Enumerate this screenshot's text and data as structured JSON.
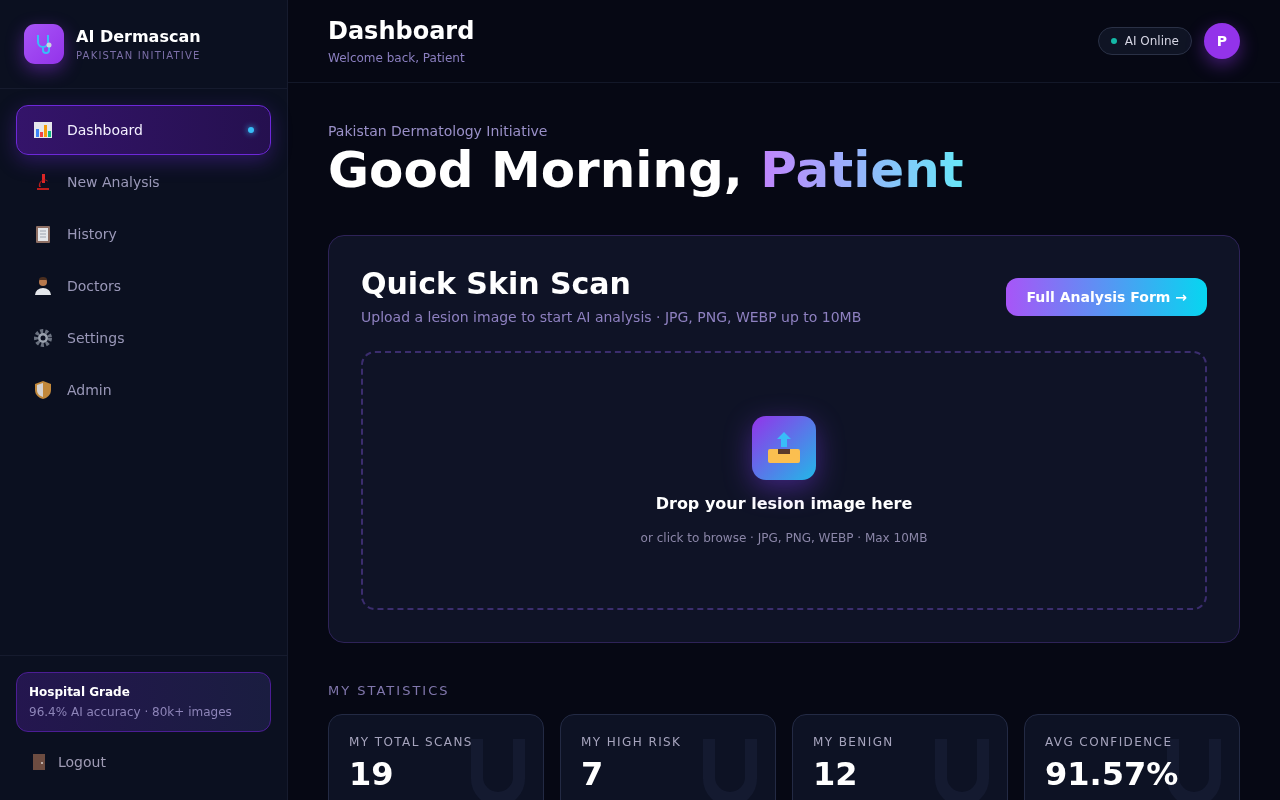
{
  "brand": {
    "name": "AI Dermascan",
    "tagline": "PAKISTAN INITIATIVE"
  },
  "nav": [
    {
      "label": "Dashboard",
      "selected": true
    },
    {
      "label": "New Analysis",
      "selected": false
    },
    {
      "label": "History",
      "selected": false
    },
    {
      "label": "Doctors",
      "selected": false
    },
    {
      "label": "Settings",
      "selected": false
    },
    {
      "label": "Admin",
      "selected": false
    }
  ],
  "promo": {
    "title": "Hospital Grade",
    "text": "96.4% AI accuracy · 80k+ images"
  },
  "logout": "Logout",
  "header": {
    "title": "Dashboard",
    "subtitle": "Welcome back, Patient",
    "status": "AI Online",
    "avatar": "P"
  },
  "hero": {
    "eyebrow": "Pakistan Dermatology Initiative",
    "greeting": "Good Morning,",
    "name": "Patient"
  },
  "scan": {
    "title": "Quick Skin Scan",
    "subtitle": "Upload a lesion image to start AI analysis · JPG, PNG, WEBP up to 10MB",
    "button": "Full Analysis Form →",
    "drop_title": "Drop your lesion image here",
    "drop_hint": "or click to browse · JPG, PNG, WEBP · Max 10MB"
  },
  "stats_heading": "MY STATISTICS",
  "stats": [
    {
      "label": "MY TOTAL SCANS",
      "value": "19"
    },
    {
      "label": "MY HIGH RISK",
      "value": "7"
    },
    {
      "label": "MY BENIGN",
      "value": "12"
    },
    {
      "label": "AVG CONFIDENCE",
      "value": "91.57%"
    }
  ]
}
